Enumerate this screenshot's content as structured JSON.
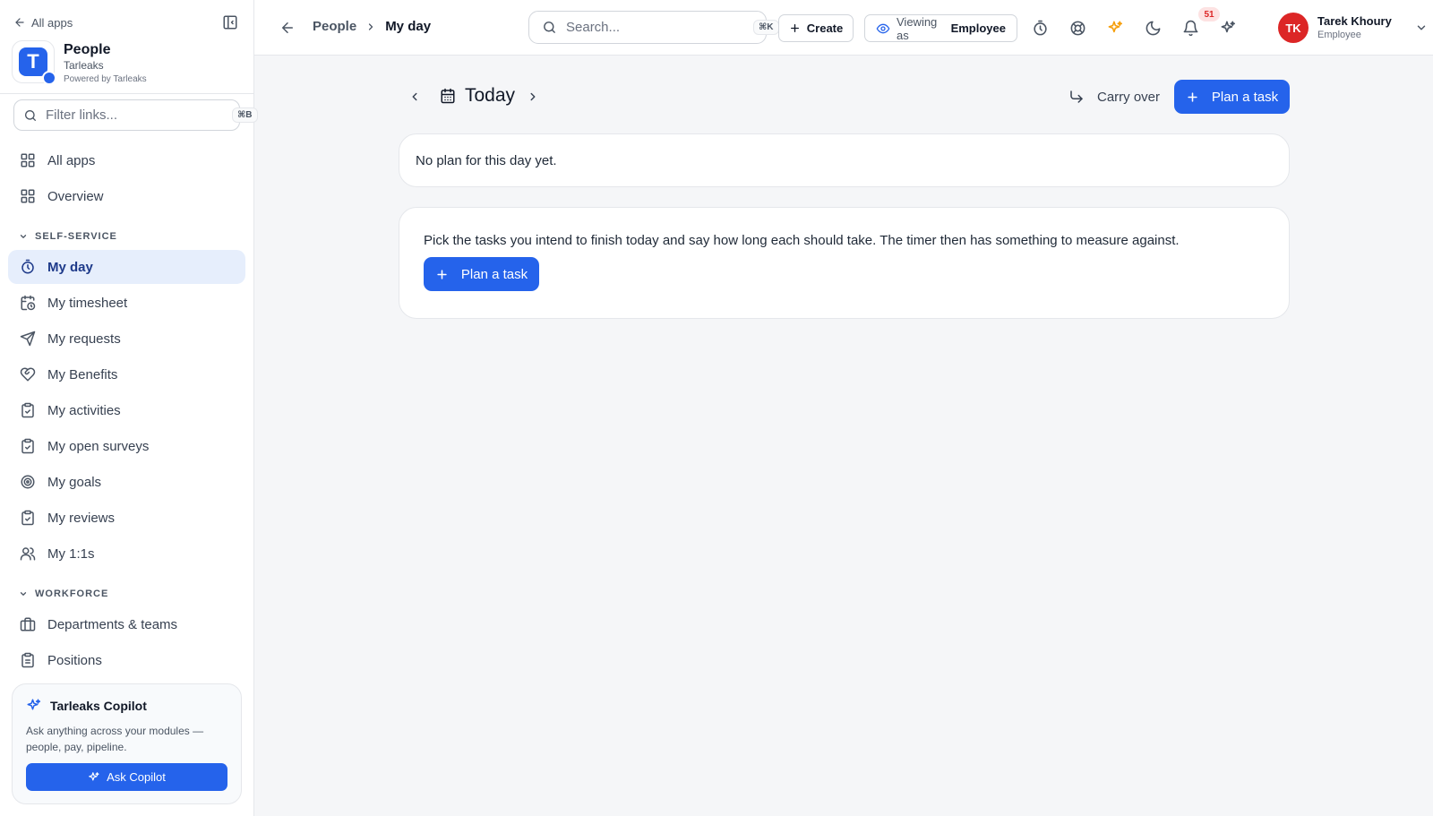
{
  "sidebar": {
    "back_label": "All apps",
    "org": {
      "logo_letter": "T",
      "title": "People",
      "subtitle": "Tarleaks",
      "powered_by": "Powered by Tarleaks"
    },
    "filter": {
      "placeholder": "Filter links...",
      "shortcut": "⌘B"
    },
    "top_items": [
      {
        "label": "All apps",
        "icon": "grid-icon"
      },
      {
        "label": "Overview",
        "icon": "grid-icon"
      }
    ],
    "sections": [
      {
        "title": "SELF-SERVICE",
        "items": [
          {
            "label": "My day",
            "icon": "timer-icon",
            "active": true
          },
          {
            "label": "My timesheet",
            "icon": "calendar-clock-icon"
          },
          {
            "label": "My requests",
            "icon": "send-icon"
          },
          {
            "label": "My Benefits",
            "icon": "heart-handshake-icon"
          },
          {
            "label": "My activities",
            "icon": "clipboard-check-icon"
          },
          {
            "label": "My open surveys",
            "icon": "clipboard-check-icon"
          },
          {
            "label": "My goals",
            "icon": "target-icon"
          },
          {
            "label": "My reviews",
            "icon": "clipboard-check-icon"
          },
          {
            "label": "My 1:1s",
            "icon": "users-icon"
          }
        ]
      },
      {
        "title": "WORKFORCE",
        "items": [
          {
            "label": "Departments & teams",
            "icon": "building-icon"
          },
          {
            "label": "Positions",
            "icon": "clipboard-list-icon"
          }
        ]
      }
    ],
    "copilot": {
      "title": "Tarleaks Copilot",
      "description": "Ask anything across your modules — people, pay, pipeline.",
      "button_label": "Ask Copilot"
    }
  },
  "topbar": {
    "breadcrumb": {
      "parent": "People",
      "current": "My day"
    },
    "search": {
      "placeholder": "Search...",
      "shortcut": "⌘K"
    },
    "create_label": "Create",
    "viewing_as": {
      "label": "Viewing as",
      "value": "Employee"
    },
    "notifications_count": "51",
    "user": {
      "initials": "TK",
      "name": "Tarek Khoury",
      "role": "Employee"
    }
  },
  "main": {
    "day_label": "Today",
    "carry_over_label": "Carry over",
    "plan_task_label": "Plan a task",
    "empty_message": "No plan for this day yet.",
    "info_text": "Pick the tasks you intend to finish today and say how long each should take. The timer then has something to measure against.",
    "info_button_label": "Plan a task"
  },
  "colors": {
    "accent": "#2563eb",
    "active_bg": "#e6eefc",
    "avatar": "#dc2626",
    "sparkle": "#f59e0b"
  }
}
